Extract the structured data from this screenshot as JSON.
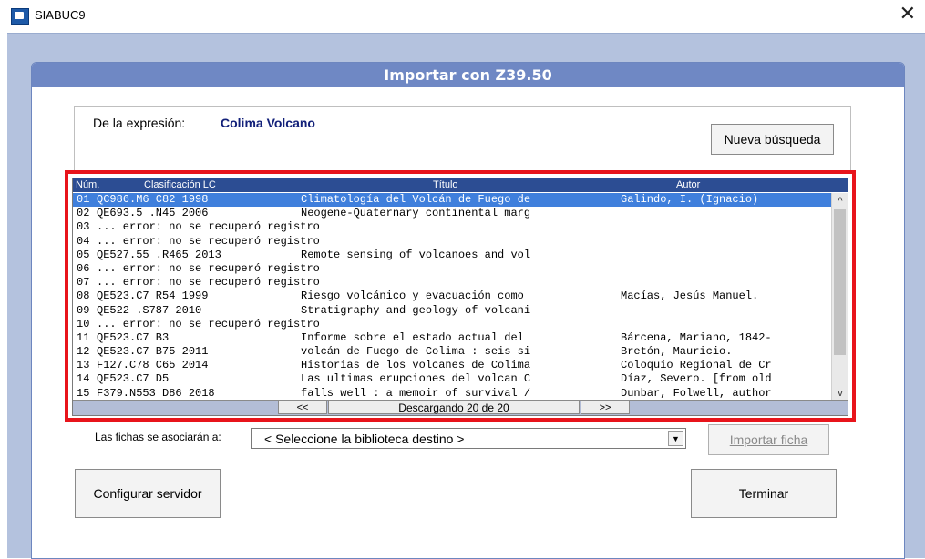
{
  "window": {
    "title": "SIABUC9",
    "close_glyph": "✕"
  },
  "dialog": {
    "title": "Importar con Z39.50"
  },
  "expression": {
    "label": "De la expresión:",
    "value": "Colima Volcano"
  },
  "buttons": {
    "new_search": "Nueva búsqueda",
    "import_record": "Importar ficha",
    "configure_server": "Configurar servidor",
    "finish": "Terminar"
  },
  "list": {
    "columns": [
      "Núm.",
      "Clasificación LC",
      "Título",
      "Autor"
    ],
    "rows": [
      {
        "num": "01",
        "cls": "QC986.M6 C82 1998",
        "title": "Climatología del Volcán de Fuego de",
        "author": "Galindo, I. (Ignacio)",
        "selected": true
      },
      {
        "num": "02",
        "cls": "QE693.5 .N45 2006",
        "title": "Neogene-Quaternary continental marg",
        "author": ""
      },
      {
        "num": "03",
        "cls": "... error: no se recuperó registro",
        "title": "",
        "author": ""
      },
      {
        "num": "04",
        "cls": "... error: no se recuperó registro",
        "title": "",
        "author": ""
      },
      {
        "num": "05",
        "cls": "QE527.55 .R465 2013",
        "title": "Remote sensing of volcanoes and vol",
        "author": ""
      },
      {
        "num": "06",
        "cls": "... error: no se recuperó registro",
        "title": "",
        "author": ""
      },
      {
        "num": "07",
        "cls": "... error: no se recuperó registro",
        "title": "",
        "author": ""
      },
      {
        "num": "08",
        "cls": "QE523.C7 R54 1999",
        "title": "Riesgo volcánico y evacuación como",
        "author": "Macías, Jesús Manuel."
      },
      {
        "num": "09",
        "cls": "QE522 .S787 2010",
        "title": "Stratigraphy and geology of volcani",
        "author": ""
      },
      {
        "num": "10",
        "cls": "... error: no se recuperó registro",
        "title": "",
        "author": ""
      },
      {
        "num": "11",
        "cls": "QE523.C7 B3",
        "title": "Informe sobre el estado actual del",
        "author": "Bárcena, Mariano, 1842-"
      },
      {
        "num": "12",
        "cls": "QE523.C7 B75 2011",
        "title": "volcán de Fuego de Colima : seis si",
        "author": "Bretón, Mauricio."
      },
      {
        "num": "13",
        "cls": "F127.C78 C65 2014",
        "title": "Historias de los volcanes de Colima",
        "author": "Coloquio Regional de Cr"
      },
      {
        "num": "14",
        "cls": "QE523.C7 D5",
        "title": "Las ultimas erupciones del volcan C",
        "author": "Díaz, Severo. [from old"
      },
      {
        "num": "15",
        "cls": "F379.N553 D86 2018",
        "title": "falls well : a memoir of survival /",
        "author": "Dunbar, Folwell, author"
      }
    ],
    "nav_prev": "<<",
    "nav_next": ">>",
    "status": "Descargando 20 de 20"
  },
  "library": {
    "label": "Las fichas se asociarán a:",
    "selected": "< Seleccione la biblioteca destino >"
  },
  "colors": {
    "header": "#6f88c4",
    "list_header": "#2c4d93",
    "selection": "#3f7fdc",
    "highlight": "#e8141b",
    "backdrop": "#b4c2de"
  }
}
